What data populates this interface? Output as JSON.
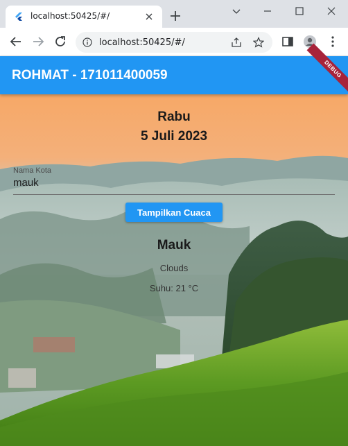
{
  "browser": {
    "tab_title": "localhost:50425/#/",
    "url": "localhost:50425/#/"
  },
  "app": {
    "title": "ROHMAT - 171011400059",
    "debug_label": "DEBUG"
  },
  "weather": {
    "day": "Rabu",
    "date": "5 Juli 2023",
    "city_label": "Nama Kota",
    "city_value": "mauk",
    "button_label": "Tampilkan Cuaca",
    "city_name": "Mauk",
    "condition": "Clouds",
    "temperature": "Suhu: 21 °C"
  },
  "colors": {
    "app_bar": "#2196f3",
    "button": "#2196f3",
    "debug_banner": "#a8233a",
    "tab_strip": "#dee1e6"
  },
  "icons": [
    "flutter-favicon",
    "close-icon",
    "plus-icon",
    "minimize-icon",
    "maximize-icon",
    "window-close-icon",
    "back-arrow-icon",
    "forward-arrow-icon",
    "reload-icon",
    "info-icon",
    "share-icon",
    "star-icon",
    "side-panel-icon",
    "profile-icon",
    "more-icon"
  ]
}
